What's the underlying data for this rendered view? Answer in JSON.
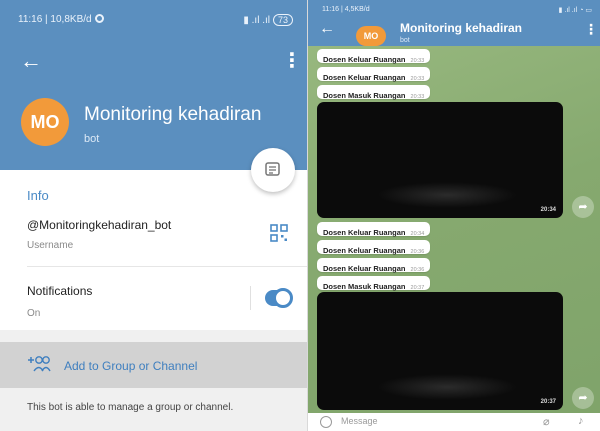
{
  "left": {
    "status_left": "11:16 | 10,8KB/d",
    "status_right": "73",
    "title": "Monitoring kehadiran",
    "subtitle": "bot",
    "avatar_initials": "MO",
    "info_label": "Info",
    "username_value": "@Monitoringkehadiran_bot",
    "username_caption": "Username",
    "notifications_label": "Notifications",
    "notifications_state": "On",
    "add_group_label": "Add to Group or Channel",
    "footer_note": "This bot is able to manage a group or channel."
  },
  "right": {
    "status_left": "11:16 | 4,5KB/d",
    "title": "Monitoring kehadiran",
    "subtitle": "bot",
    "avatar_initials": "MO",
    "messages_top": [
      {
        "text": "Dosen Keluar Ruangan",
        "time": "20:33"
      },
      {
        "text": "Dosen Keluar Ruangan",
        "time": "20:33"
      },
      {
        "text": "Dosen Masuk Ruangan",
        "time": "20:33"
      }
    ],
    "video1_time": "20:34",
    "messages_mid": [
      {
        "text": "Dosen Keluar Ruangan",
        "time": "20:34"
      },
      {
        "text": "Dosen Keluar Ruangan",
        "time": "20:36"
      },
      {
        "text": "Dosen Keluar Ruangan",
        "time": "20:36"
      },
      {
        "text": "Dosen Masuk Ruangan",
        "time": "20:37"
      }
    ],
    "video2_time": "20:37",
    "input_placeholder": "Message"
  },
  "colors": {
    "header_blue": "#5b8fbf",
    "accent_blue": "#4a8ac6",
    "avatar_orange": "#f29a3a",
    "chat_green": "#8fb07a"
  },
  "icons": [
    "back-arrow-icon",
    "kebab-menu-icon",
    "message-icon",
    "qr-code-icon",
    "add-group-icon",
    "share-icon",
    "emoji-icon",
    "attach-icon",
    "mic-icon",
    "settings-gear-icon"
  ]
}
